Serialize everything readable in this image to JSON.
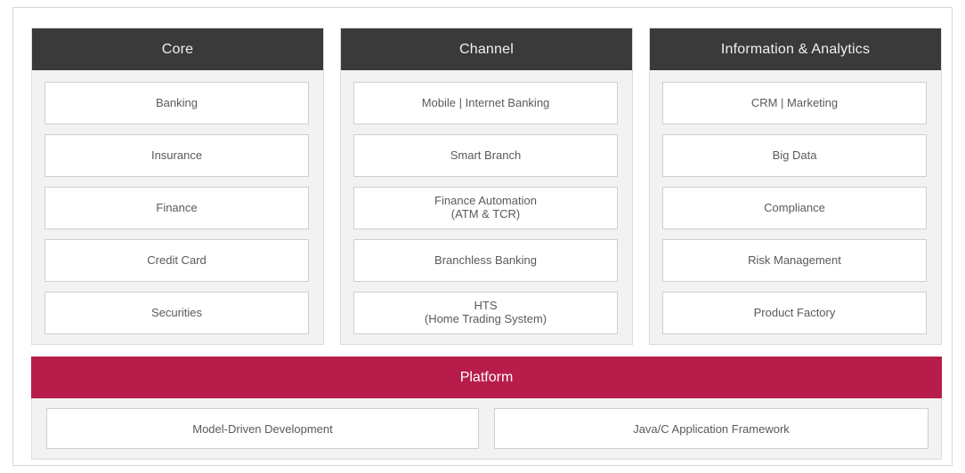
{
  "columns": [
    {
      "title": "Core",
      "items": [
        "Banking",
        "Insurance",
        "Finance",
        "Credit Card",
        "Securities"
      ]
    },
    {
      "title": "Channel",
      "items": [
        "Mobile | Internet Banking",
        "Smart Branch",
        "Finance Automation\n(ATM & TCR)",
        "Branchless Banking",
        "HTS\n(Home Trading System)"
      ]
    },
    {
      "title": "Information & Analytics",
      "items": [
        "CRM | Marketing",
        "Big Data",
        "Compliance",
        "Risk Management",
        "Product Factory"
      ]
    }
  ],
  "platform": {
    "title": "Platform",
    "items": [
      "Model-Driven Development",
      "Java/C Application Framework"
    ]
  },
  "colors": {
    "header_dark": "#3a3a3a",
    "platform_accent": "#b81c4b",
    "panel_bg": "#f2f2f2"
  }
}
